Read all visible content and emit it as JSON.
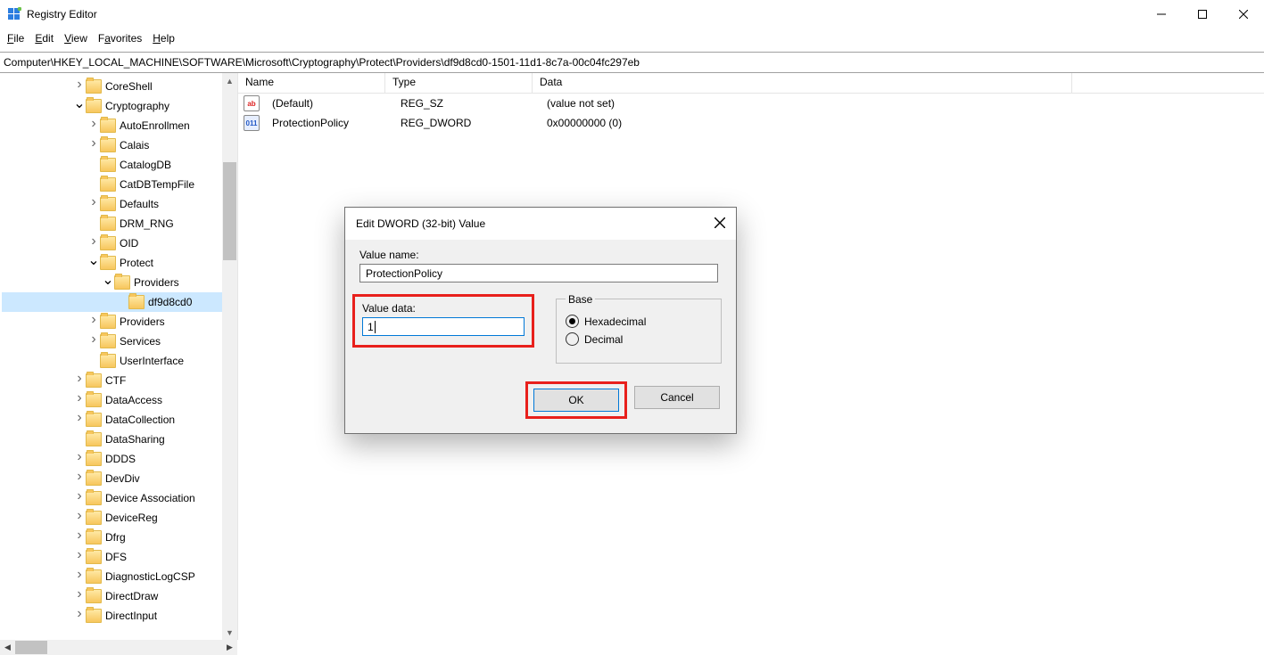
{
  "title": "Registry Editor",
  "menu": {
    "file": "File",
    "edit": "Edit",
    "view": "View",
    "favorites": "Favorites",
    "help": "Help"
  },
  "address": "Computer\\HKEY_LOCAL_MACHINE\\SOFTWARE\\Microsoft\\Cryptography\\Protect\\Providers\\df9d8cd0-1501-11d1-8c7a-00c04fc297eb",
  "tree": {
    "items": [
      {
        "indent": 5,
        "arrow": ">",
        "label": "CoreShell"
      },
      {
        "indent": 5,
        "arrow": "v",
        "label": "Cryptography"
      },
      {
        "indent": 6,
        "arrow": ">",
        "label": "AutoEnrollmen"
      },
      {
        "indent": 6,
        "arrow": ">",
        "label": "Calais"
      },
      {
        "indent": 6,
        "arrow": "",
        "label": "CatalogDB"
      },
      {
        "indent": 6,
        "arrow": "",
        "label": "CatDBTempFile"
      },
      {
        "indent": 6,
        "arrow": ">",
        "label": "Defaults"
      },
      {
        "indent": 6,
        "arrow": "",
        "label": "DRM_RNG"
      },
      {
        "indent": 6,
        "arrow": ">",
        "label": "OID"
      },
      {
        "indent": 6,
        "arrow": "v",
        "label": "Protect"
      },
      {
        "indent": 7,
        "arrow": "v",
        "label": "Providers"
      },
      {
        "indent": 8,
        "arrow": "",
        "label": "df9d8cd0",
        "selected": true
      },
      {
        "indent": 6,
        "arrow": ">",
        "label": "Providers"
      },
      {
        "indent": 6,
        "arrow": ">",
        "label": "Services"
      },
      {
        "indent": 6,
        "arrow": "",
        "label": "UserInterface"
      },
      {
        "indent": 5,
        "arrow": ">",
        "label": "CTF"
      },
      {
        "indent": 5,
        "arrow": ">",
        "label": "DataAccess"
      },
      {
        "indent": 5,
        "arrow": ">",
        "label": "DataCollection"
      },
      {
        "indent": 5,
        "arrow": "",
        "label": "DataSharing"
      },
      {
        "indent": 5,
        "arrow": ">",
        "label": "DDDS"
      },
      {
        "indent": 5,
        "arrow": ">",
        "label": "DevDiv"
      },
      {
        "indent": 5,
        "arrow": ">",
        "label": "Device Association"
      },
      {
        "indent": 5,
        "arrow": ">",
        "label": "DeviceReg"
      },
      {
        "indent": 5,
        "arrow": ">",
        "label": "Dfrg"
      },
      {
        "indent": 5,
        "arrow": ">",
        "label": "DFS"
      },
      {
        "indent": 5,
        "arrow": ">",
        "label": "DiagnosticLogCSP"
      },
      {
        "indent": 5,
        "arrow": ">",
        "label": "DirectDraw"
      },
      {
        "indent": 5,
        "arrow": ">",
        "label": "DirectInput"
      }
    ]
  },
  "columns": {
    "name": "Name",
    "type": "Type",
    "data": "Data"
  },
  "values": [
    {
      "icon": "sz",
      "name": "(Default)",
      "type": "REG_SZ",
      "data": "(value not set)"
    },
    {
      "icon": "dw",
      "name": "ProtectionPolicy",
      "type": "REG_DWORD",
      "data": "0x00000000 (0)"
    }
  ],
  "dialog": {
    "title": "Edit DWORD (32-bit) Value",
    "valueNameLabel": "Value name:",
    "valueName": "ProtectionPolicy",
    "valueDataLabel": "Value data:",
    "valueData": "1",
    "baseLabel": "Base",
    "hex": "Hexadecimal",
    "dec": "Decimal",
    "ok": "OK",
    "cancel": "Cancel"
  },
  "iconText": {
    "sz": "ab",
    "dw": "011"
  }
}
